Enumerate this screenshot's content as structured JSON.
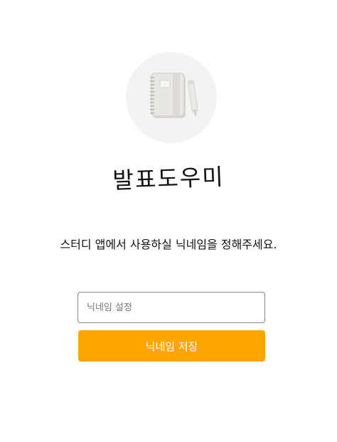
{
  "app": {
    "title": "발표도우미"
  },
  "logo": {
    "icon": "notebook-pen-icon"
  },
  "instruction": "스터디 앱에서 사용하실 닉네임을 정해주세요.",
  "form": {
    "nickname_placeholder": "닉네임 설정",
    "nickname_value": "",
    "save_label": "닉네임 저장"
  },
  "colors": {
    "accent": "#ffa500",
    "logo_bg": "#f3f3f3",
    "input_border": "#8a8a8a"
  }
}
